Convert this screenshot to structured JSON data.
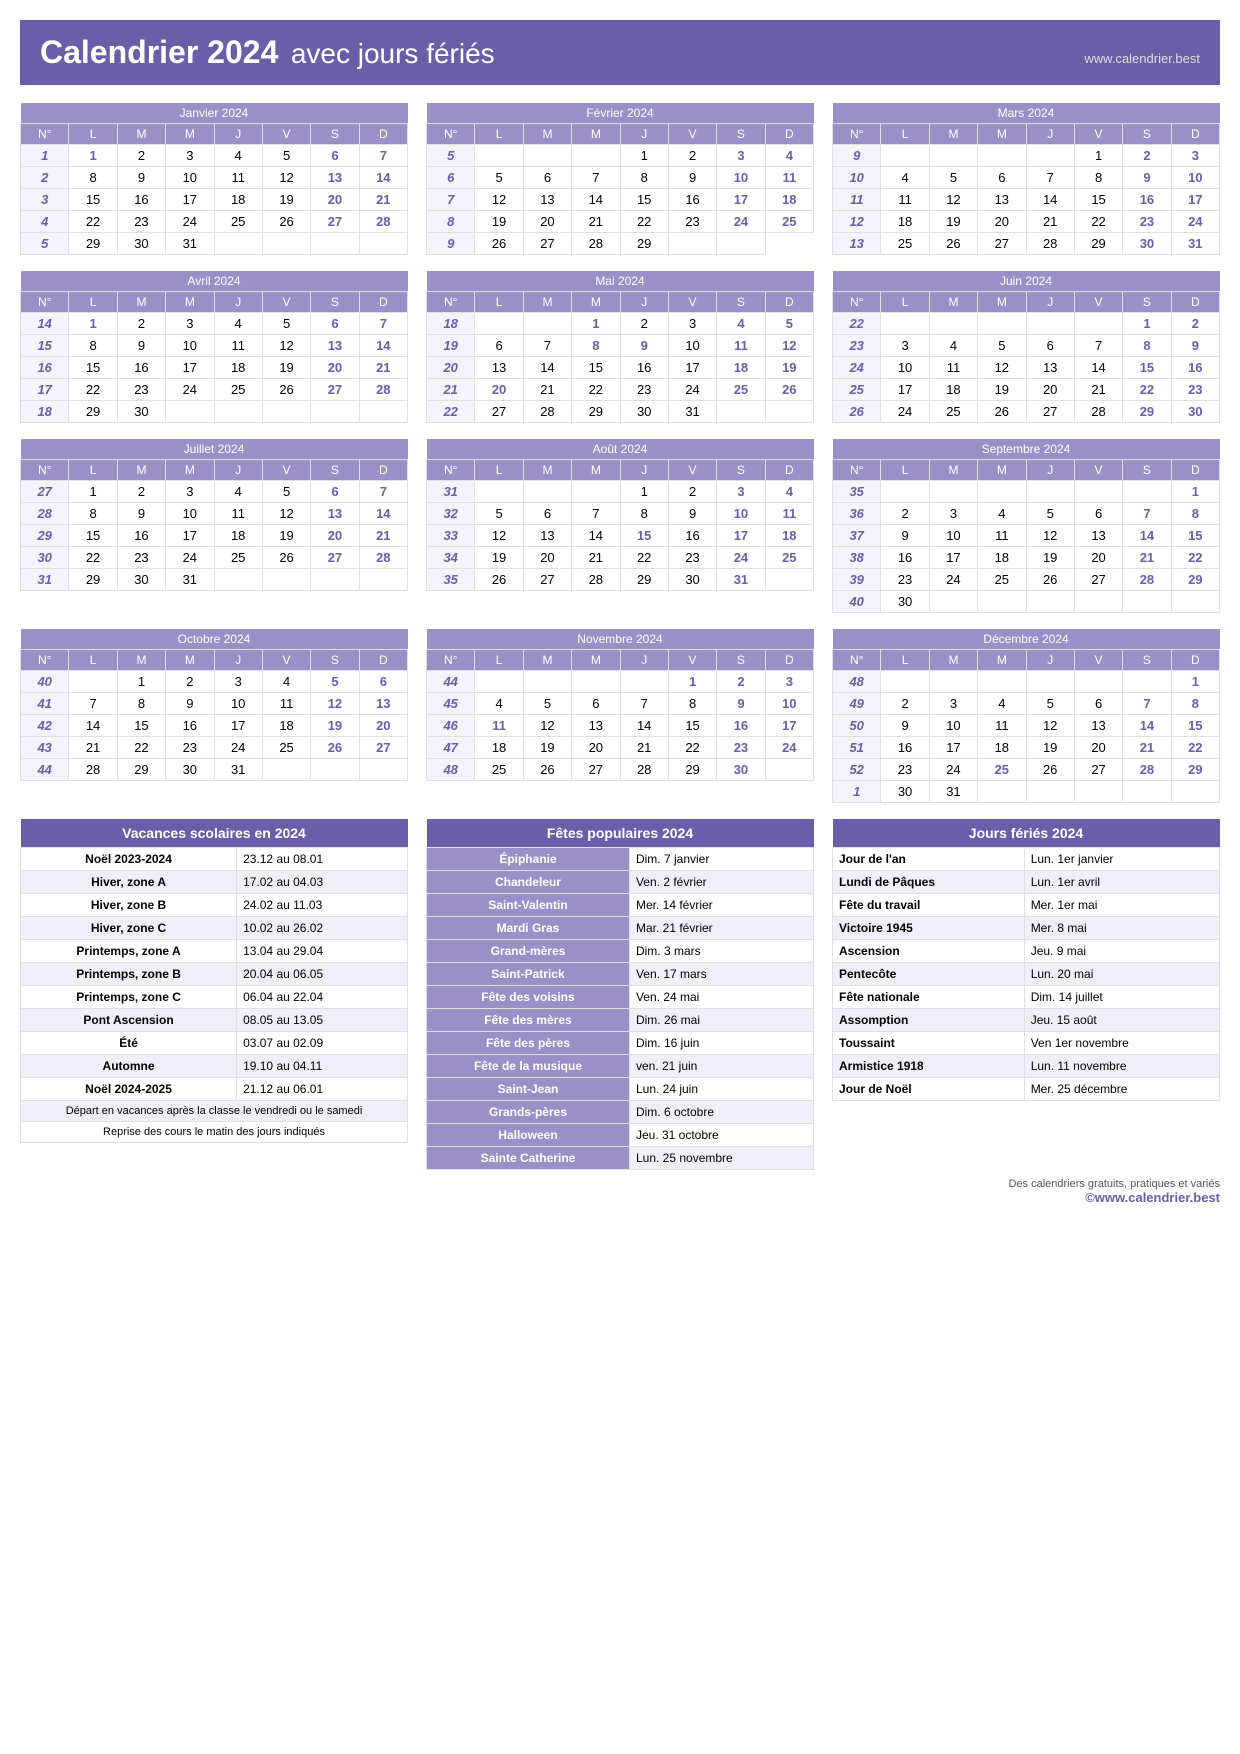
{
  "header": {
    "title": "Calendrier 2024",
    "subtitle": "avec jours fériés",
    "url": "www.calendrier.best"
  },
  "months": [
    {
      "name": "Janvier 2024",
      "weeks": [
        {
          "num": "N°",
          "days": [
            "L",
            "M",
            "M",
            "J",
            "V",
            "S",
            "D"
          ]
        },
        {
          "num": "1",
          "days": [
            "1",
            "2",
            "3",
            "4",
            "5",
            "6",
            "7"
          ]
        },
        {
          "num": "2",
          "days": [
            "8",
            "9",
            "10",
            "11",
            "12",
            "13",
            "14"
          ]
        },
        {
          "num": "3",
          "days": [
            "15",
            "16",
            "17",
            "18",
            "19",
            "20",
            "21"
          ]
        },
        {
          "num": "4",
          "days": [
            "22",
            "23",
            "24",
            "25",
            "26",
            "27",
            "28"
          ]
        },
        {
          "num": "5",
          "days": [
            "29",
            "30",
            "31",
            "",
            "",
            "",
            ""
          ]
        }
      ],
      "holidays": [
        "1"
      ],
      "saturdays": [
        6,
        13,
        20,
        27
      ],
      "sundays": [
        7,
        14,
        21,
        28
      ]
    },
    {
      "name": "Février 2024",
      "weeks": [
        {
          "num": "N°",
          "days": [
            "L",
            "M",
            "M",
            "J",
            "V",
            "S",
            "D"
          ]
        },
        {
          "num": "5",
          "days": [
            "",
            "",
            "",
            "1",
            "2",
            "3",
            "4"
          ]
        },
        {
          "num": "6",
          "days": [
            "5",
            "6",
            "7",
            "8",
            "9",
            "10",
            "11"
          ]
        },
        {
          "num": "7",
          "days": [
            "12",
            "13",
            "14",
            "15",
            "16",
            "17",
            "18"
          ]
        },
        {
          "num": "8",
          "days": [
            "19",
            "20",
            "21",
            "22",
            "23",
            "24",
            "25"
          ]
        },
        {
          "num": "9",
          "days": [
            "26",
            "27",
            "28",
            "29",
            "",
            ""
          ]
        }
      ]
    },
    {
      "name": "Mars 2024",
      "weeks": [
        {
          "num": "N°",
          "days": [
            "L",
            "M",
            "M",
            "J",
            "V",
            "S",
            "D"
          ]
        },
        {
          "num": "9",
          "days": [
            "",
            "",
            "",
            "",
            "1",
            "2",
            "3"
          ]
        },
        {
          "num": "10",
          "days": [
            "4",
            "5",
            "6",
            "7",
            "8",
            "9",
            "10"
          ]
        },
        {
          "num": "11",
          "days": [
            "11",
            "12",
            "13",
            "14",
            "15",
            "16",
            "17"
          ]
        },
        {
          "num": "12",
          "days": [
            "18",
            "19",
            "20",
            "21",
            "22",
            "23",
            "24"
          ]
        },
        {
          "num": "13",
          "days": [
            "25",
            "26",
            "27",
            "28",
            "29",
            "30",
            "31"
          ]
        }
      ]
    },
    {
      "name": "Avril 2024",
      "weeks": [
        {
          "num": "N°",
          "days": [
            "L",
            "M",
            "M",
            "J",
            "V",
            "S",
            "D"
          ]
        },
        {
          "num": "14",
          "days": [
            "1",
            "2",
            "3",
            "4",
            "5",
            "6",
            "7"
          ]
        },
        {
          "num": "15",
          "days": [
            "8",
            "9",
            "10",
            "11",
            "12",
            "13",
            "14"
          ]
        },
        {
          "num": "16",
          "days": [
            "15",
            "16",
            "17",
            "18",
            "19",
            "20",
            "21"
          ]
        },
        {
          "num": "17",
          "days": [
            "22",
            "23",
            "24",
            "25",
            "26",
            "27",
            "28"
          ]
        },
        {
          "num": "18",
          "days": [
            "29",
            "30",
            "",
            "",
            "",
            "",
            ""
          ]
        }
      ]
    },
    {
      "name": "Mai 2024",
      "weeks": [
        {
          "num": "N°",
          "days": [
            "L",
            "M",
            "M",
            "J",
            "V",
            "S",
            "D"
          ]
        },
        {
          "num": "18",
          "days": [
            "",
            "",
            "1",
            "2",
            "3",
            "4",
            "5"
          ]
        },
        {
          "num": "19",
          "days": [
            "6",
            "7",
            "8",
            "9",
            "10",
            "11",
            "12"
          ]
        },
        {
          "num": "20",
          "days": [
            "13",
            "14",
            "15",
            "16",
            "17",
            "18",
            "19"
          ]
        },
        {
          "num": "21",
          "days": [
            "20",
            "21",
            "22",
            "23",
            "24",
            "25",
            "26"
          ]
        },
        {
          "num": "22",
          "days": [
            "27",
            "28",
            "29",
            "30",
            "31",
            "",
            ""
          ]
        }
      ]
    },
    {
      "name": "Juin 2024",
      "weeks": [
        {
          "num": "N°",
          "days": [
            "L",
            "M",
            "M",
            "J",
            "V",
            "S",
            "D"
          ]
        },
        {
          "num": "22",
          "days": [
            "",
            "",
            "",
            "",
            "",
            "1",
            "2"
          ]
        },
        {
          "num": "23",
          "days": [
            "3",
            "4",
            "5",
            "6",
            "7",
            "8",
            "9"
          ]
        },
        {
          "num": "24",
          "days": [
            "10",
            "11",
            "12",
            "13",
            "14",
            "15",
            "16"
          ]
        },
        {
          "num": "25",
          "days": [
            "17",
            "18",
            "19",
            "20",
            "21",
            "22",
            "23"
          ]
        },
        {
          "num": "26",
          "days": [
            "24",
            "25",
            "26",
            "27",
            "28",
            "29",
            "30"
          ]
        }
      ]
    },
    {
      "name": "Juillet 2024",
      "weeks": [
        {
          "num": "N°",
          "days": [
            "L",
            "M",
            "M",
            "J",
            "V",
            "S",
            "D"
          ]
        },
        {
          "num": "27",
          "days": [
            "1",
            "2",
            "3",
            "4",
            "5",
            "6",
            "7"
          ]
        },
        {
          "num": "28",
          "days": [
            "8",
            "9",
            "10",
            "11",
            "12",
            "13",
            "14"
          ]
        },
        {
          "num": "29",
          "days": [
            "15",
            "16",
            "17",
            "18",
            "19",
            "20",
            "21"
          ]
        },
        {
          "num": "30",
          "days": [
            "22",
            "23",
            "24",
            "25",
            "26",
            "27",
            "28"
          ]
        },
        {
          "num": "31",
          "days": [
            "29",
            "30",
            "31",
            "",
            "",
            "",
            ""
          ]
        }
      ]
    },
    {
      "name": "Août 2024",
      "weeks": [
        {
          "num": "N°",
          "days": [
            "L",
            "M",
            "M",
            "J",
            "V",
            "S",
            "D"
          ]
        },
        {
          "num": "31",
          "days": [
            "",
            "",
            "",
            "1",
            "2",
            "3",
            "4"
          ]
        },
        {
          "num": "32",
          "days": [
            "5",
            "6",
            "7",
            "8",
            "9",
            "10",
            "11"
          ]
        },
        {
          "num": "33",
          "days": [
            "12",
            "13",
            "14",
            "15",
            "16",
            "17",
            "18"
          ]
        },
        {
          "num": "34",
          "days": [
            "19",
            "20",
            "21",
            "22",
            "23",
            "24",
            "25"
          ]
        },
        {
          "num": "35",
          "days": [
            "26",
            "27",
            "28",
            "29",
            "30",
            "31",
            ""
          ]
        }
      ]
    },
    {
      "name": "Septembre 2024",
      "weeks": [
        {
          "num": "N°",
          "days": [
            "L",
            "M",
            "M",
            "J",
            "V",
            "S",
            "D"
          ]
        },
        {
          "num": "35",
          "days": [
            "",
            "",
            "",
            "",
            "",
            "",
            "1"
          ]
        },
        {
          "num": "36",
          "days": [
            "2",
            "3",
            "4",
            "5",
            "6",
            "7",
            "8"
          ]
        },
        {
          "num": "37",
          "days": [
            "9",
            "10",
            "11",
            "12",
            "13",
            "14",
            "15"
          ]
        },
        {
          "num": "38",
          "days": [
            "16",
            "17",
            "18",
            "19",
            "20",
            "21",
            "22"
          ]
        },
        {
          "num": "39",
          "days": [
            "23",
            "24",
            "25",
            "26",
            "27",
            "28",
            "29"
          ]
        },
        {
          "num": "40",
          "days": [
            "30",
            "",
            "",
            "",
            "",
            "",
            ""
          ]
        }
      ]
    },
    {
      "name": "Octobre 2024",
      "weeks": [
        {
          "num": "N°",
          "days": [
            "L",
            "M",
            "M",
            "J",
            "V",
            "S",
            "D"
          ]
        },
        {
          "num": "40",
          "days": [
            "",
            "1",
            "2",
            "3",
            "4",
            "5",
            "6"
          ]
        },
        {
          "num": "41",
          "days": [
            "7",
            "8",
            "9",
            "10",
            "11",
            "12",
            "13"
          ]
        },
        {
          "num": "42",
          "days": [
            "14",
            "15",
            "16",
            "17",
            "18",
            "19",
            "20"
          ]
        },
        {
          "num": "43",
          "days": [
            "21",
            "22",
            "23",
            "24",
            "25",
            "26",
            "27"
          ]
        },
        {
          "num": "44",
          "days": [
            "28",
            "29",
            "30",
            "31",
            "",
            "",
            ""
          ]
        }
      ]
    },
    {
      "name": "Novembre 2024",
      "weeks": [
        {
          "num": "N°",
          "days": [
            "L",
            "M",
            "M",
            "J",
            "V",
            "S",
            "D"
          ]
        },
        {
          "num": "44",
          "days": [
            "",
            "",
            "",
            "",
            "1",
            "2",
            "3"
          ]
        },
        {
          "num": "45",
          "days": [
            "4",
            "5",
            "6",
            "7",
            "8",
            "9",
            "10"
          ]
        },
        {
          "num": "46",
          "days": [
            "11",
            "12",
            "13",
            "14",
            "15",
            "16",
            "17"
          ]
        },
        {
          "num": "47",
          "days": [
            "18",
            "19",
            "20",
            "21",
            "22",
            "23",
            "24"
          ]
        },
        {
          "num": "48",
          "days": [
            "25",
            "26",
            "27",
            "28",
            "29",
            "30",
            ""
          ]
        }
      ]
    },
    {
      "name": "Décembre 2024",
      "weeks": [
        {
          "num": "N°",
          "days": [
            "L",
            "M",
            "M",
            "J",
            "V",
            "S",
            "D"
          ]
        },
        {
          "num": "48",
          "days": [
            "",
            "",
            "",
            "",
            "",
            "",
            "1"
          ]
        },
        {
          "num": "49",
          "days": [
            "2",
            "3",
            "4",
            "5",
            "6",
            "7",
            "8"
          ]
        },
        {
          "num": "50",
          "days": [
            "9",
            "10",
            "11",
            "12",
            "13",
            "14",
            "15"
          ]
        },
        {
          "num": "51",
          "days": [
            "16",
            "17",
            "18",
            "19",
            "20",
            "21",
            "22"
          ]
        },
        {
          "num": "52",
          "days": [
            "23",
            "24",
            "25",
            "26",
            "27",
            "28",
            "29"
          ]
        },
        {
          "num": "1",
          "days": [
            "30",
            "31",
            "",
            "",
            "",
            "",
            ""
          ]
        }
      ]
    }
  ],
  "vacances": {
    "title": "Vacances scolaires en 2024",
    "rows": [
      {
        "label": "Noël 2023-2024",
        "date": "23.12 au 08.01"
      },
      {
        "label": "Hiver, zone A",
        "date": "17.02 au 04.03"
      },
      {
        "label": "Hiver, zone B",
        "date": "24.02 au 11.03"
      },
      {
        "label": "Hiver, zone C",
        "date": "10.02 au 26.02"
      },
      {
        "label": "Printemps, zone A",
        "date": "13.04 au 29.04"
      },
      {
        "label": "Printemps, zone B",
        "date": "20.04 au 06.05"
      },
      {
        "label": "Printemps, zone C",
        "date": "06.04 au 22.04"
      },
      {
        "label": "Pont Ascension",
        "date": "08.05 au 13.05"
      },
      {
        "label": "Été",
        "date": "03.07 au 02.09"
      },
      {
        "label": "Automne",
        "date": "19.10 au 04.11"
      },
      {
        "label": "Noël 2024-2025",
        "date": "21.12 au 06.01"
      }
    ],
    "note1": "Départ en vacances après la classe le vendredi ou le samedi",
    "note2": "Reprise des cours le matin des jours indiqués"
  },
  "fetes": {
    "title": "Fêtes populaires 2024",
    "rows": [
      {
        "label": "Épiphanie",
        "date": "Dim. 7 janvier"
      },
      {
        "label": "Chandeleur",
        "date": "Ven. 2 février"
      },
      {
        "label": "Saint-Valentin",
        "date": "Mer. 14 février"
      },
      {
        "label": "Mardi Gras",
        "date": "Mar. 21 février"
      },
      {
        "label": "Grand-mères",
        "date": "Dim. 3 mars"
      },
      {
        "label": "Saint-Patrick",
        "date": "Ven. 17 mars"
      },
      {
        "label": "Fête des voisins",
        "date": "Ven. 24 mai"
      },
      {
        "label": "Fête des mères",
        "date": "Dim. 26 mai"
      },
      {
        "label": "Fête des pères",
        "date": "Dim. 16 juin"
      },
      {
        "label": "Fête de la musique",
        "date": "ven. 21 juin"
      },
      {
        "label": "Saint-Jean",
        "date": "Lun. 24 juin"
      },
      {
        "label": "Grands-pères",
        "date": "Dim. 6 octobre"
      },
      {
        "label": "Halloween",
        "date": "Jeu. 31 octobre"
      },
      {
        "label": "Sainte Catherine",
        "date": "Lun. 25 novembre"
      }
    ]
  },
  "jours_feries": {
    "title": "Jours fériés 2024",
    "rows": [
      {
        "label": "Jour de l'an",
        "date": "Lun. 1er janvier"
      },
      {
        "label": "Lundi de Pâques",
        "date": "Lun. 1er avril"
      },
      {
        "label": "Fête du travail",
        "date": "Mer. 1er mai"
      },
      {
        "label": "Victoire 1945",
        "date": "Mer. 8 mai"
      },
      {
        "label": "Ascension",
        "date": "Jeu. 9 mai"
      },
      {
        "label": "Pentecôte",
        "date": "Lun. 20 mai"
      },
      {
        "label": "Fête nationale",
        "date": "Dim. 14 juillet"
      },
      {
        "label": "Assomption",
        "date": "Jeu. 15 août"
      },
      {
        "label": "Toussaint",
        "date": "Ven 1er novembre"
      },
      {
        "label": "Armistice 1918",
        "date": "Lun. 11 novembre"
      },
      {
        "label": "Jour de Noël",
        "date": "Mer. 25 décembre"
      }
    ]
  },
  "footer": {
    "free_cals": "Des calendriers gratuits, pratiques et variés",
    "url": "©www.calendrier.best"
  }
}
